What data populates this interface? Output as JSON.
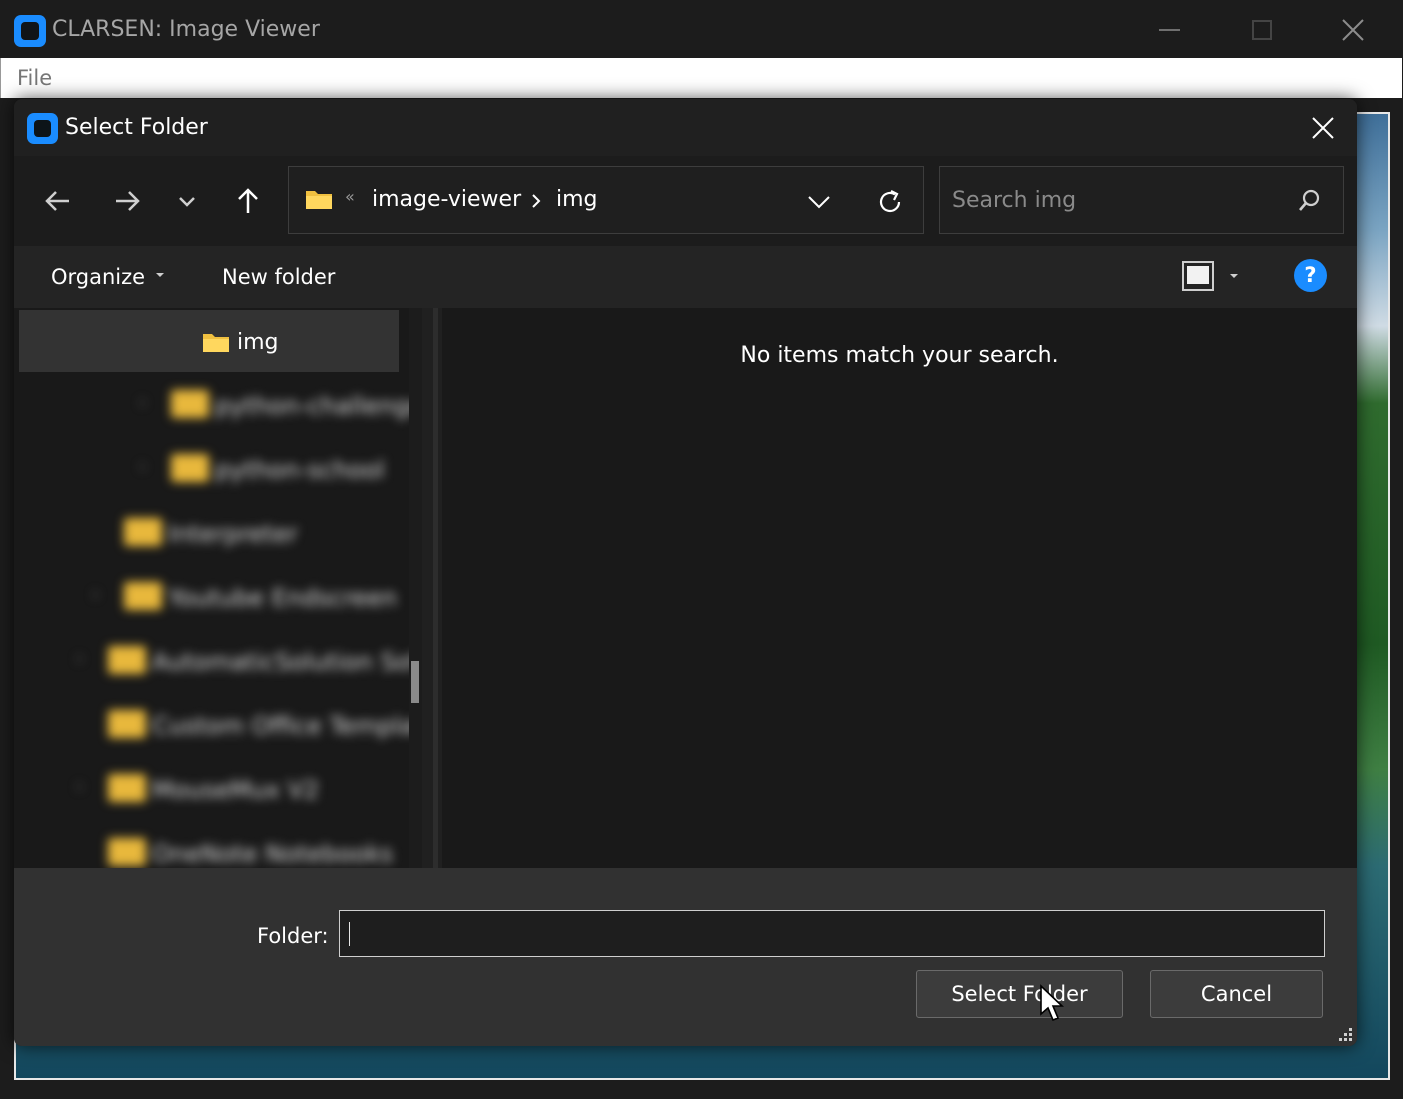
{
  "app": {
    "title": "CLARSEN: Image Viewer",
    "menu": {
      "file": "File"
    }
  },
  "dialog": {
    "title": "Select Folder",
    "breadcrumb": {
      "overflow": "«",
      "items": [
        "image-viewer",
        "img"
      ]
    },
    "search": {
      "placeholder": "Search img"
    },
    "toolbar": {
      "organize": "Organize",
      "new_folder": "New folder",
      "help": "?"
    },
    "nav_pane": {
      "selected": "img",
      "items": [
        {
          "label": "python-challenge",
          "expandable": true
        },
        {
          "label": "python-school",
          "expandable": true
        },
        {
          "label": "Interpreter",
          "expandable": false
        },
        {
          "label": "Youtube Endscreen",
          "expandable": true
        },
        {
          "label": "AutomaticSolution Software",
          "expandable": true
        },
        {
          "label": "Custom Office Templates",
          "expandable": false
        },
        {
          "label": "MouseMux V2",
          "expandable": true
        },
        {
          "label": "OneNote Notebooks",
          "expandable": false
        }
      ]
    },
    "content": {
      "empty_message": "No items match your search."
    },
    "footer": {
      "folder_label": "Folder:",
      "folder_value": "",
      "select_button": "Select Folder",
      "cancel_button": "Cancel"
    }
  },
  "colors": {
    "accent": "#1a8cff",
    "folder": "#f0c040",
    "dialog_bg": "#202020",
    "footer_bg": "#313131"
  }
}
